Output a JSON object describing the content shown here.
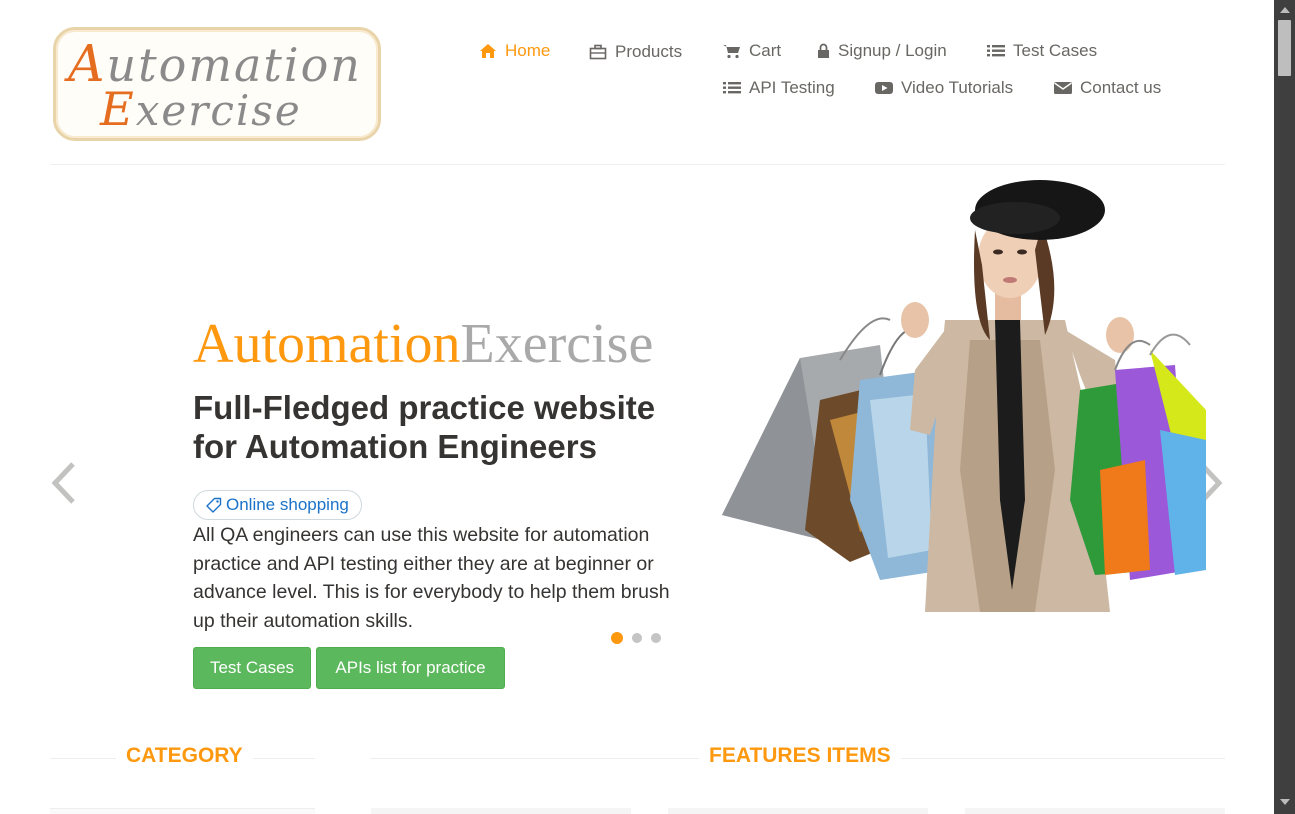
{
  "logo": {
    "line1_cap": "A",
    "line1_rest": "utomation",
    "line2_cap": "E",
    "line2_rest": "xercise"
  },
  "nav": {
    "home": "Home",
    "products": "Products",
    "cart": "Cart",
    "signup": "Signup / Login",
    "test_cases": "Test Cases",
    "api_testing": "API Testing",
    "video_tutorials": "Video Tutorials",
    "contact": "Contact us"
  },
  "slider": {
    "brand_part1": "Automation",
    "brand_part2": "Exercise",
    "headline": "Full-Fledged practice website for Automation Engineers",
    "tag": "Online shopping",
    "description": "All QA engineers can use this website for automation practice and API testing either they are at beginner or advance level. This is for everybody to help them brush up their automation skills.",
    "btn_test_cases": "Test Cases",
    "btn_apis": "APIs list for practice",
    "active_slide": 1,
    "slide_count": 3
  },
  "sections": {
    "category": "CATEGORY",
    "features": "FEATURES ITEMS"
  },
  "colors": {
    "accent": "#fe980f",
    "button_green": "#5cb85c",
    "tag_blue": "#1a73c8",
    "text": "#696763"
  },
  "icons": [
    "home-icon",
    "briefcase-icon",
    "cart-icon",
    "lock-icon",
    "list-icon",
    "youtube-icon",
    "envelope-icon",
    "tag-icon",
    "chevron-left-icon",
    "chevron-right-icon"
  ]
}
